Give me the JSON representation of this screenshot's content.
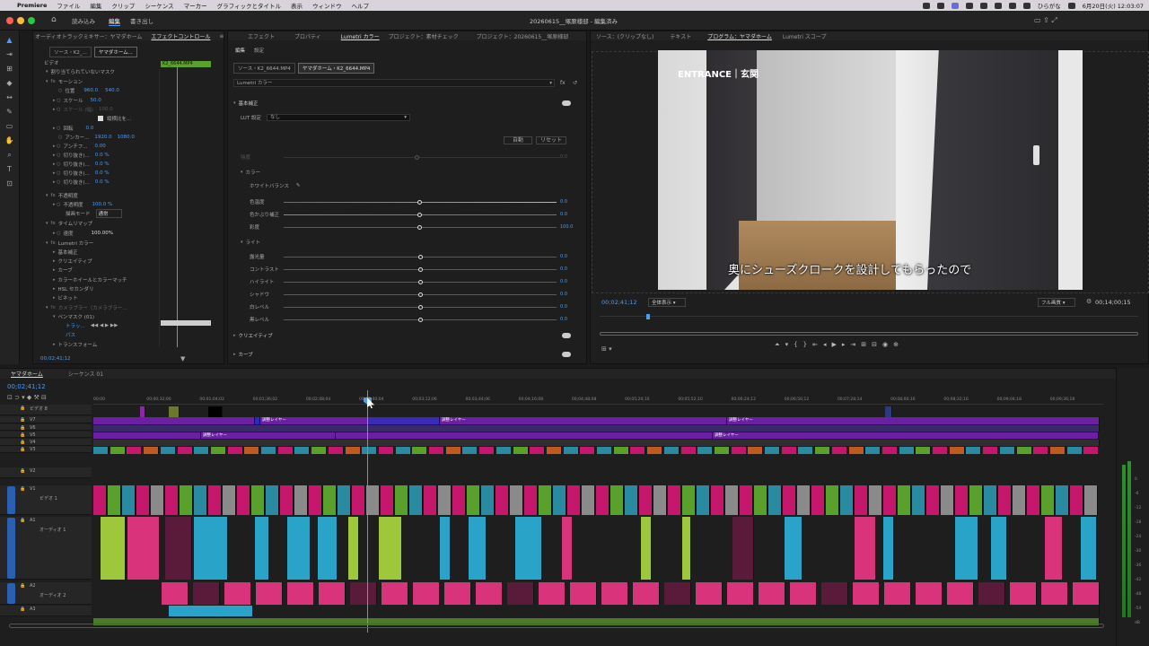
{
  "menubar": {
    "app": "Premiere",
    "items": [
      "ファイル",
      "編集",
      "クリップ",
      "シーケンス",
      "マーカー",
      "グラフィックとタイトル",
      "表示",
      "ウィンドウ",
      "ヘルプ"
    ],
    "ime": "ひらがな",
    "datetime": "6月20日(火) 12:03:07"
  },
  "header": {
    "workspaces": [
      "読み込み",
      "編集",
      "書き出し"
    ],
    "active": "編集",
    "title": "20260615__塚原様邸 - 編集済み"
  },
  "left_panel": {
    "tabs": [
      "オーディオトラックミキサー：ヤマダホーム",
      "エフェクトコントロール",
      "≡"
    ],
    "source_tabs": [
      "ソース・K2_...",
      "ヤマダホーム..."
    ],
    "clip_label": "K2_6644.MP4",
    "section_video": "ビデオ",
    "mask_note": "割り当てられていないマスク",
    "motion": "モーション",
    "position_label": "位置",
    "position_x": "960.0",
    "position_y": "540.0",
    "scale_label": "スケール",
    "scale_val": "50.0",
    "scale_w_label": "スケール (幅)",
    "scale_w_val": "100.0",
    "uniform_label": "縦横比を...",
    "rotation_label": "回転",
    "rotation_val": "0.0",
    "anchor_label": "アンカー...",
    "anchor_x": "1920.0",
    "anchor_y": "1080.0",
    "antiflicker_label": "アンチフ...",
    "antiflicker_val": "0.00",
    "crop1": "切り抜き(...",
    "crop1v": "0.0 %",
    "crop2": "切り抜き(...",
    "crop2v": "0.0 %",
    "crop3": "切り抜き(...",
    "crop3v": "0.0 %",
    "crop4": "切り抜き(...",
    "crop4v": "0.0 %",
    "opacity": "不透明度",
    "opacity_label": "不透明度",
    "opacity_val": "100.0 %",
    "blend_label": "描画モード",
    "blend_val": "通常",
    "timeremap": "タイムリマップ",
    "speed_label": "速度",
    "speed_val": "100.00%",
    "lumetri": "Lumetri カラー",
    "lum_items": [
      "基本補正",
      "クリエイティブ",
      "カーブ",
      "カラーホイールとカラーマッチ",
      "HSL セカンダリ",
      "ビネット"
    ],
    "camera_blur": "カメラブラー（カメラブラー...",
    "pen_mask": "ペンマスク (01)",
    "track": "トラッ...",
    "path": "パス",
    "transform": "トランスフォーム",
    "timecode": "00;02;41;12"
  },
  "lumetri_panel": {
    "tabs": [
      "エフェクト",
      "プロパティ",
      "Lumetri カラー",
      "プロジェクト：素材チェック",
      "プロジェクト：20260615__塚原様邸"
    ],
    "subtabs": [
      "編集",
      "設定"
    ],
    "clip_tabs": [
      "ソース・K2_6644.MP4",
      "ヤマダホーム・K2_6644.MP4"
    ],
    "dropdown": "Lumetri カラー",
    "basic": "基本補正",
    "lut_label": "LUT 設定",
    "lut_val": "なし",
    "auto": "自動",
    "reset": "リセット",
    "intensity": "強度",
    "intensity_val": "0.0",
    "color": "カラー",
    "wb": "ホワイトバランス",
    "temp": "色温度",
    "temp_val": "0.0",
    "tint": "色かぶり補正",
    "tint_val": "0.0",
    "sat": "彩度",
    "sat_val": "100.0",
    "light": "ライト",
    "exposure": "露光量",
    "exposure_val": "0.0",
    "contrast": "コントラスト",
    "contrast_val": "0.0",
    "highlight": "ハイライト",
    "highlight_val": "0.0",
    "shadow": "シャドウ",
    "shadow_val": "0.0",
    "white": "白レベル",
    "white_val": "0.0",
    "black": "黒レベル",
    "black_val": "0.0",
    "creative": "クリエイティブ",
    "curves": "カーブ"
  },
  "monitor": {
    "tabs": [
      "ソース：(クリップなし)",
      "テキスト",
      "プログラム：ヤマダホーム",
      "Lumetri スコープ"
    ],
    "overlay_title": "ENTRANCE｜玄関",
    "subtitle": "奥にシューズクロークを設計してもらったので",
    "timecode": "00;02;41;12",
    "fit": "全体表示",
    "quality": "フル画質",
    "duration": "00;14;00;15"
  },
  "timeline": {
    "tabs": [
      "ヤマダホーム",
      "シーケンス 01"
    ],
    "timecode": "00;02;41;12",
    "ruler": [
      "00;00",
      "00;00;32;00",
      "00;01;04;02",
      "00;01;36;02",
      "00;02;08;04",
      "00;02;40;04",
      "00;03;12;06",
      "00;03;44;06",
      "00;04;16;08",
      "00;04;48;08",
      "00;05;20;10",
      "00;05;52;10",
      "00;06;24;12",
      "00;06;56;12",
      "00;07;28;14",
      "00;08;00;16",
      "00;08;32;16",
      "00;09;04;18",
      "00;09;36;18"
    ],
    "tracks": {
      "v8": "ビデオ 8",
      "v7": "V7",
      "v6": "V6",
      "v5": "V5",
      "v4": "V4",
      "v3": "V3",
      "v2": "V2",
      "v1": "V1",
      "v1name": "ビデオ 1",
      "a1": "A1",
      "a1name": "オーディオ 1",
      "a2": "A2",
      "a2name": "オーディオ 2",
      "a3": "A3"
    },
    "adjust_label": "調整レイヤー",
    "meter": [
      "0",
      "-6",
      "-12",
      "-18",
      "-24",
      "-30",
      "-36",
      "-42",
      "-48",
      "-54",
      "dB"
    ]
  },
  "colors": {
    "accent": "#4d9bf5",
    "v_purple": "#6b1fa3",
    "v_pink": "#c5176c",
    "a_green": "#9fc73b",
    "a_cyan": "#2aa3c9",
    "a_pink": "#d8337b"
  }
}
